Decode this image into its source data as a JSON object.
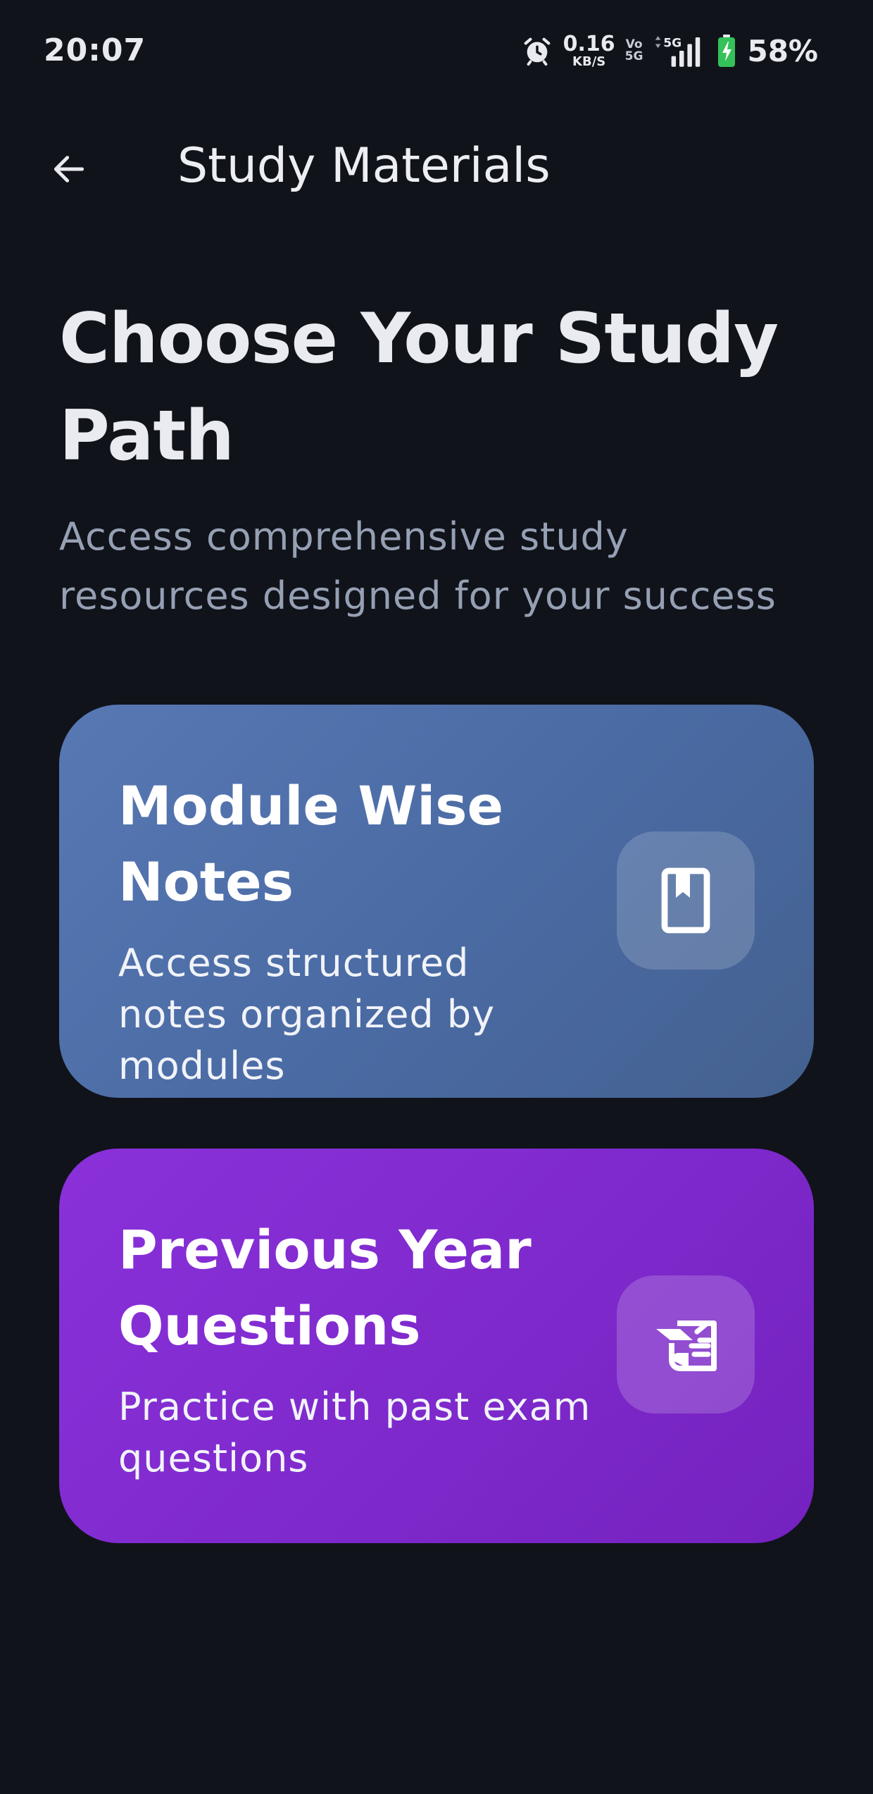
{
  "status_bar": {
    "time": "20:07",
    "alarm_icon": "alarm-clock-icon",
    "net_speed": "0.16",
    "net_unit": "KB/S",
    "volte_top": "Vo",
    "volte_bottom": "5G",
    "network": "5G",
    "battery_percent": "58%",
    "battery_icon": "battery-charging-icon"
  },
  "app_bar": {
    "back_icon": "arrow-left-icon",
    "title": "Study Materials"
  },
  "header": {
    "title": "Choose Your Study Path",
    "subtitle": "Access comprehensive study resources designed for your success"
  },
  "cards": [
    {
      "title": "Module Wise Notes",
      "description": "Access structured notes organized by modules",
      "icon": "book-bookmark-icon",
      "color": "#5271ad"
    },
    {
      "title": "Previous Year Questions",
      "description": "Practice with past exam questions",
      "icon": "quiz-scroll-icon",
      "color": "#842dd3"
    }
  ],
  "colors": {
    "background": "#10131a",
    "text_primary": "#e9ebf1",
    "text_secondary": "#96a0b4"
  }
}
